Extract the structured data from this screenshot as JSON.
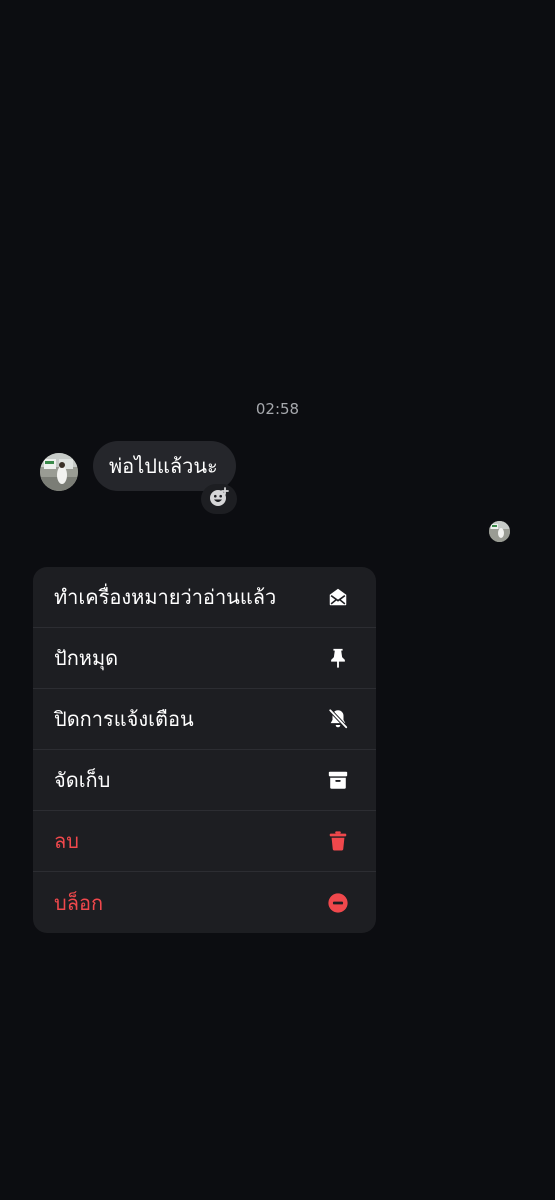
{
  "chat": {
    "timestamp": "02:58",
    "message": "พ่อไปแล้วนะ"
  },
  "colors": {
    "background": "#0c0d11",
    "bubble": "#25262b",
    "menu_background": "#1d1e22",
    "danger": "#f0484c"
  },
  "menu": {
    "items": [
      {
        "label": "ทำเครื่องหมายว่าอ่านแล้ว",
        "icon": "envelope-open-icon"
      },
      {
        "label": "ปักหมุด",
        "icon": "pin-icon"
      },
      {
        "label": "ปิดการแจ้งเตือน",
        "icon": "bell-off-icon"
      },
      {
        "label": "จัดเก็บ",
        "icon": "archive-icon"
      },
      {
        "label": "ลบ",
        "icon": "trash-icon"
      },
      {
        "label": "บล็อก",
        "icon": "block-icon"
      }
    ]
  }
}
